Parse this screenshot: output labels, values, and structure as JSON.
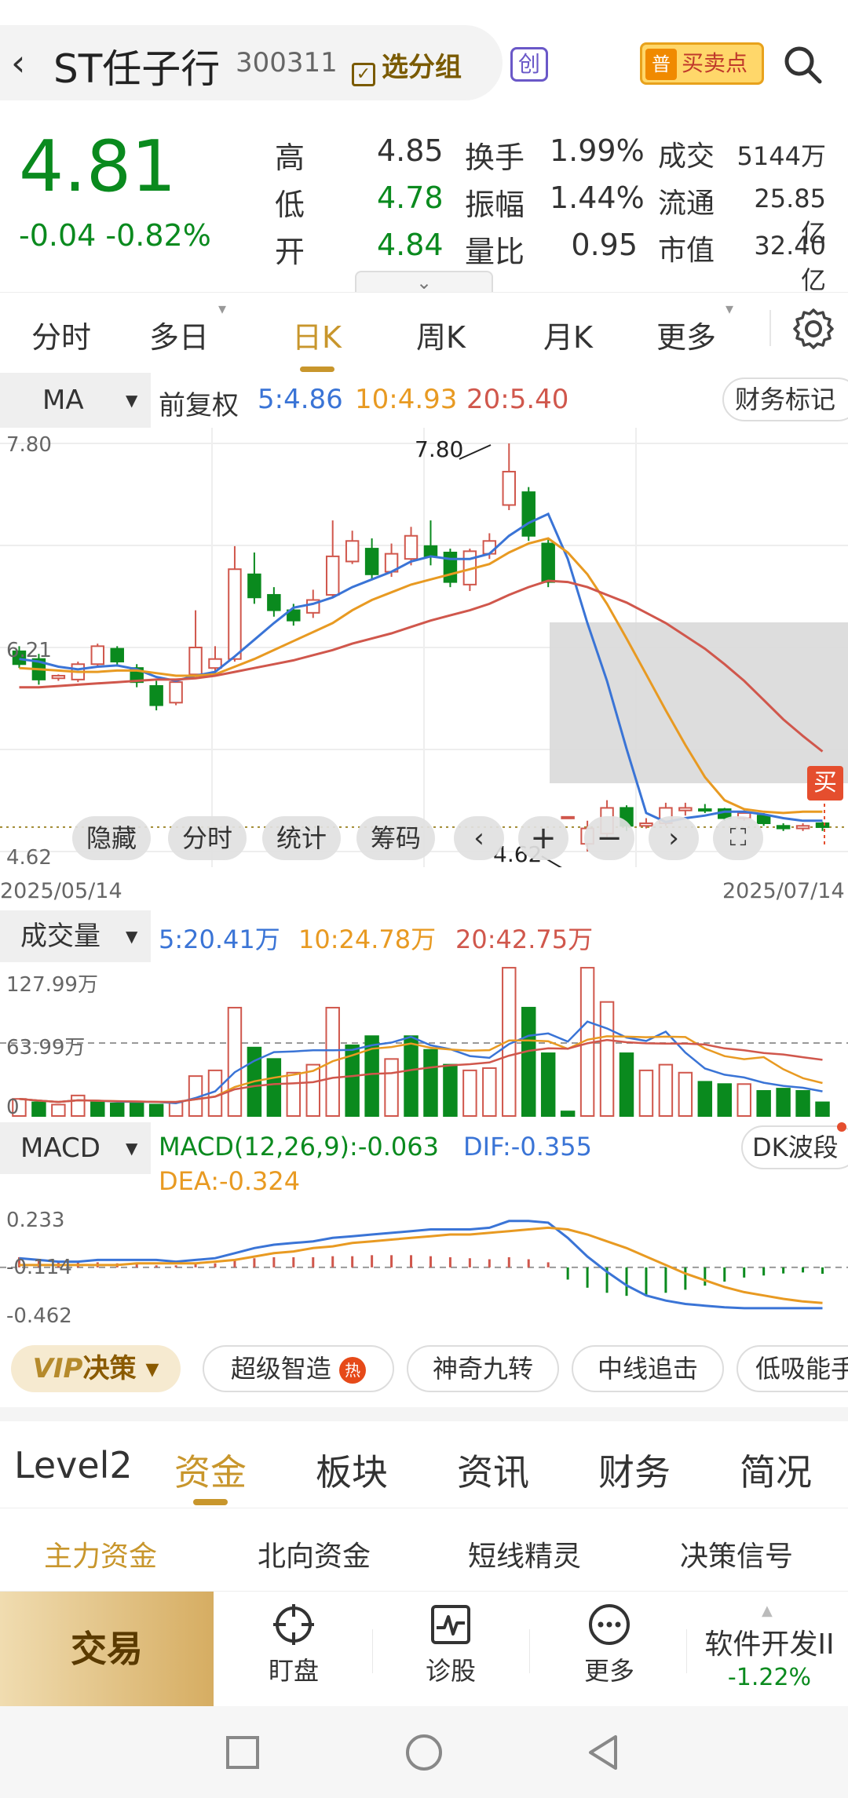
{
  "header": {
    "back_icon": "chevron-left-icon",
    "stock_name": "ST任子行",
    "stock_code": "300311",
    "group_label": "选分组",
    "board_badge": "创",
    "buysell_badge": "普",
    "buysell_label": "买卖点",
    "search_icon": "search-icon"
  },
  "quote": {
    "price": "4.81",
    "change": "-0.04 -0.82%",
    "rows": [
      {
        "k1": "高",
        "v1": "4.85",
        "k2": "换手",
        "v2": "1.99%",
        "k3": "成交",
        "v3": "5144万"
      },
      {
        "k1": "低",
        "v1": "4.78",
        "k2": "振幅",
        "v2": "1.44%",
        "k3": "流通",
        "v3": "25.85亿"
      },
      {
        "k1": "开",
        "v1": "4.84",
        "k2": "量比",
        "v2": "0.95",
        "k3": "市值",
        "v3": "32.40亿"
      }
    ],
    "expand_icon": "chevron-down-icon"
  },
  "ktabs": [
    "分时",
    "多日",
    "日K",
    "周K",
    "月K",
    "更多"
  ],
  "ktab_active": "日K",
  "ma_bar": {
    "selector": "MA",
    "adjust": "前复权",
    "ma5": "5:4.86",
    "ma10": "10:4.93",
    "ma20": "20:5.40",
    "finance_mark": "财务标记"
  },
  "kline_axis": {
    "top": "7.80",
    "mid": "6.21",
    "bottom": "4.62",
    "high_label": "7.80",
    "low_label": "4.62",
    "start_date": "2025/05/14",
    "end_date": "2025/07/14",
    "buy_badge": "买"
  },
  "chart_controls": [
    "隐藏",
    "分时",
    "统计",
    "筹码"
  ],
  "volume": {
    "selector": "成交量",
    "ma5": "5:20.41万",
    "ma10": "10:24.78万",
    "ma20": "20:42.75万",
    "top": "127.99万",
    "mid": "63.99万",
    "zero": "0"
  },
  "macd": {
    "selector": "MACD",
    "macd": "MACD(12,26,9):-0.063",
    "dif": "DIF:-0.355",
    "dea": "DEA:-0.324",
    "dk": "DK波段",
    "top": "0.233",
    "mid": "-0.114",
    "bottom": "-0.462"
  },
  "features": {
    "vip": "决策",
    "vip_prefix": "VIP",
    "chips": [
      "超级智造",
      "神奇九转",
      "中线追击",
      "低吸能手"
    ],
    "hot": "热"
  },
  "bottom_tabs": [
    "Level2",
    "资金",
    "板块",
    "资讯",
    "财务",
    "简况"
  ],
  "bottom_tab_active": "资金",
  "sub_tabs": [
    "主力资金",
    "北向资金",
    "短线精灵",
    "决策信号"
  ],
  "sub_tab_active": "主力资金",
  "bottom_bar": {
    "trade": "交易",
    "items": [
      {
        "label": "盯盘",
        "icon": "target-icon"
      },
      {
        "label": "诊股",
        "icon": "pulse-chart-icon"
      },
      {
        "label": "更多",
        "icon": "more-dots-icon"
      }
    ],
    "sector_name": "软件开发II",
    "sector_change": "-1.22%"
  },
  "colors": {
    "up": "#d0574c",
    "down": "#0a8a1e",
    "ma5": "#3a74d6",
    "ma10": "#e89a22",
    "ma20": "#d0574c",
    "accent": "#c8962c"
  },
  "chart_data": [
    {
      "type": "candlestick",
      "title": "日K",
      "ylim": [
        4.62,
        7.8
      ],
      "x_range": [
        "2025/05/14",
        "2025/07/14"
      ],
      "candles": [
        {
          "o": 6.18,
          "c": 6.08,
          "h": 6.22,
          "l": 6.05
        },
        {
          "o": 6.12,
          "c": 5.96,
          "h": 6.16,
          "l": 5.92
        },
        {
          "o": 5.97,
          "c": 5.99,
          "h": 6.0,
          "l": 5.95
        },
        {
          "o": 5.96,
          "c": 6.08,
          "h": 6.1,
          "l": 5.94
        },
        {
          "o": 6.08,
          "c": 6.22,
          "h": 6.24,
          "l": 6.06
        },
        {
          "o": 6.2,
          "c": 6.1,
          "h": 6.22,
          "l": 6.06
        },
        {
          "o": 6.05,
          "c": 5.94,
          "h": 6.08,
          "l": 5.9
        },
        {
          "o": 5.91,
          "c": 5.76,
          "h": 5.95,
          "l": 5.72
        },
        {
          "o": 5.78,
          "c": 5.94,
          "h": 5.96,
          "l": 5.76
        },
        {
          "o": 6.0,
          "c": 6.21,
          "h": 6.5,
          "l": 5.98
        },
        {
          "o": 6.05,
          "c": 6.12,
          "h": 6.22,
          "l": 6.0
        },
        {
          "o": 6.12,
          "c": 6.82,
          "h": 7.0,
          "l": 6.1
        },
        {
          "o": 6.78,
          "c": 6.6,
          "h": 6.95,
          "l": 6.55
        },
        {
          "o": 6.62,
          "c": 6.5,
          "h": 6.68,
          "l": 6.45
        },
        {
          "o": 6.5,
          "c": 6.42,
          "h": 6.55,
          "l": 6.38
        },
        {
          "o": 6.48,
          "c": 6.58,
          "h": 6.66,
          "l": 6.44
        },
        {
          "o": 6.62,
          "c": 6.92,
          "h": 7.2,
          "l": 6.6
        },
        {
          "o": 6.88,
          "c": 7.04,
          "h": 7.12,
          "l": 6.86
        },
        {
          "o": 6.98,
          "c": 6.78,
          "h": 7.06,
          "l": 6.74
        },
        {
          "o": 6.8,
          "c": 6.94,
          "h": 7.02,
          "l": 6.76
        },
        {
          "o": 6.9,
          "c": 7.08,
          "h": 7.15,
          "l": 6.85
        },
        {
          "o": 7.0,
          "c": 6.92,
          "h": 7.2,
          "l": 6.85
        },
        {
          "o": 6.95,
          "c": 6.72,
          "h": 6.98,
          "l": 6.68
        },
        {
          "o": 6.7,
          "c": 6.96,
          "h": 6.98,
          "l": 6.65
        },
        {
          "o": 6.94,
          "c": 7.04,
          "h": 7.1,
          "l": 6.9
        },
        {
          "o": 7.32,
          "c": 7.58,
          "h": 7.8,
          "l": 7.28
        },
        {
          "o": 7.42,
          "c": 7.08,
          "h": 7.46,
          "l": 7.04
        },
        {
          "o": 7.02,
          "c": 6.72,
          "h": 7.05,
          "l": 6.68
        },
        {
          "o": 4.89,
          "c": 4.89,
          "h": 4.89,
          "l": 4.89
        },
        {
          "o": 4.68,
          "c": 4.8,
          "h": 4.86,
          "l": 4.62
        },
        {
          "o": 4.76,
          "c": 4.96,
          "h": 5.02,
          "l": 4.72
        },
        {
          "o": 4.96,
          "c": 4.82,
          "h": 4.98,
          "l": 4.78
        },
        {
          "o": 4.82,
          "c": 4.84,
          "h": 4.88,
          "l": 4.8
        },
        {
          "o": 4.84,
          "c": 4.96,
          "h": 5.0,
          "l": 4.82
        },
        {
          "o": 4.94,
          "c": 4.96,
          "h": 5.0,
          "l": 4.9
        },
        {
          "o": 4.95,
          "c": 4.94,
          "h": 4.99,
          "l": 4.92
        },
        {
          "o": 4.95,
          "c": 4.88,
          "h": 4.96,
          "l": 4.86
        },
        {
          "o": 4.88,
          "c": 4.92,
          "h": 4.94,
          "l": 4.86
        },
        {
          "o": 4.9,
          "c": 4.84,
          "h": 4.92,
          "l": 4.82
        },
        {
          "o": 4.82,
          "c": 4.8,
          "h": 4.84,
          "l": 4.78
        },
        {
          "o": 4.8,
          "c": 4.82,
          "h": 4.84,
          "l": 4.78
        },
        {
          "o": 4.84,
          "c": 4.81,
          "h": 4.85,
          "l": 4.78
        }
      ],
      "series": [
        {
          "name": "MA5",
          "values": [
            6.12,
            6.1,
            6.06,
            6.04,
            6.06,
            6.07,
            6.04,
            5.98,
            5.95,
            5.99,
            6.02,
            6.14,
            6.27,
            6.4,
            6.52,
            6.55,
            6.6,
            6.68,
            6.74,
            6.8,
            6.88,
            6.92,
            6.9,
            6.9,
            6.94,
            7.08,
            7.18,
            7.25,
            6.9,
            6.4,
            5.95,
            5.42,
            4.92,
            4.85,
            4.88,
            4.9,
            4.93,
            4.93,
            4.91,
            4.88,
            4.86,
            4.86
          ]
        },
        {
          "name": "MA10",
          "values": [
            6.05,
            6.04,
            6.03,
            6.02,
            6.02,
            6.03,
            6.03,
            6.01,
            5.99,
            5.99,
            6.0,
            6.06,
            6.12,
            6.19,
            6.26,
            6.33,
            6.4,
            6.5,
            6.58,
            6.64,
            6.7,
            6.74,
            6.78,
            6.82,
            6.86,
            6.95,
            7.02,
            7.06,
            6.95,
            6.78,
            6.55,
            6.28,
            6.0,
            5.72,
            5.45,
            5.2,
            5.02,
            4.95,
            4.93,
            4.92,
            4.93,
            4.93
          ]
        },
        {
          "name": "MA20",
          "values": [
            5.9,
            5.9,
            5.91,
            5.92,
            5.93,
            5.94,
            5.95,
            5.96,
            5.96,
            5.97,
            5.99,
            6.02,
            6.05,
            6.08,
            6.11,
            6.15,
            6.19,
            6.24,
            6.28,
            6.32,
            6.37,
            6.42,
            6.46,
            6.5,
            6.55,
            6.62,
            6.68,
            6.73,
            6.72,
            6.68,
            6.62,
            6.56,
            6.48,
            6.4,
            6.3,
            6.2,
            6.08,
            5.95,
            5.8,
            5.65,
            5.52,
            5.4
          ]
        }
      ]
    },
    {
      "type": "bar",
      "title": "成交量",
      "ylabel": "万",
      "ylim": [
        0,
        127.99
      ],
      "values": [
        15,
        12,
        10,
        18,
        12,
        11,
        11,
        10,
        12,
        35,
        40,
        95,
        60,
        50,
        38,
        45,
        95,
        62,
        70,
        50,
        70,
        58,
        45,
        40,
        42,
        130,
        95,
        55,
        4,
        130,
        100,
        55,
        40,
        45,
        38,
        30,
        28,
        28,
        22,
        24,
        22,
        12
      ],
      "up": [
        1,
        0,
        1,
        1,
        0,
        0,
        0,
        0,
        1,
        1,
        1,
        1,
        0,
        0,
        1,
        1,
        1,
        0,
        0,
        1,
        0,
        0,
        0,
        1,
        1,
        1,
        0,
        0,
        0,
        1,
        1,
        0,
        1,
        1,
        1,
        0,
        0,
        1,
        0,
        0,
        0,
        0
      ]
    },
    {
      "type": "bar",
      "title": "MACD",
      "ylim": [
        -0.462,
        0.233
      ],
      "values": [
        0.1,
        0.08,
        0.06,
        0.05,
        0.05,
        0.04,
        0.03,
        0.02,
        0.02,
        0.03,
        0.04,
        0.08,
        0.09,
        0.1,
        0.1,
        0.1,
        0.11,
        0.11,
        0.12,
        0.12,
        0.12,
        0.11,
        0.1,
        0.09,
        0.08,
        0.1,
        0.08,
        0.05,
        -0.12,
        -0.2,
        -0.25,
        -0.28,
        -0.28,
        -0.25,
        -0.22,
        -0.18,
        -0.14,
        -0.1,
        -0.08,
        -0.06,
        -0.05,
        -0.063
      ],
      "series": [
        {
          "name": "DIF",
          "values": [
            -0.06,
            -0.07,
            -0.08,
            -0.08,
            -0.07,
            -0.07,
            -0.07,
            -0.07,
            -0.08,
            -0.07,
            -0.06,
            -0.03,
            0.0,
            0.02,
            0.03,
            0.04,
            0.06,
            0.07,
            0.08,
            0.09,
            0.1,
            0.11,
            0.11,
            0.11,
            0.12,
            0.16,
            0.16,
            0.15,
            0.06,
            -0.05,
            -0.14,
            -0.22,
            -0.28,
            -0.31,
            -0.33,
            -0.34,
            -0.35,
            -0.355,
            -0.355,
            -0.355,
            -0.355,
            -0.355
          ]
        },
        {
          "name": "DEA",
          "values": [
            -0.1,
            -0.1,
            -0.1,
            -0.1,
            -0.1,
            -0.1,
            -0.09,
            -0.09,
            -0.09,
            -0.09,
            -0.08,
            -0.07,
            -0.05,
            -0.03,
            -0.02,
            0.0,
            0.01,
            0.03,
            0.04,
            0.05,
            0.06,
            0.07,
            0.08,
            0.08,
            0.09,
            0.1,
            0.11,
            0.12,
            0.11,
            0.08,
            0.04,
            0.0,
            -0.05,
            -0.1,
            -0.15,
            -0.19,
            -0.23,
            -0.26,
            -0.28,
            -0.3,
            -0.315,
            -0.324
          ]
        }
      ]
    }
  ]
}
